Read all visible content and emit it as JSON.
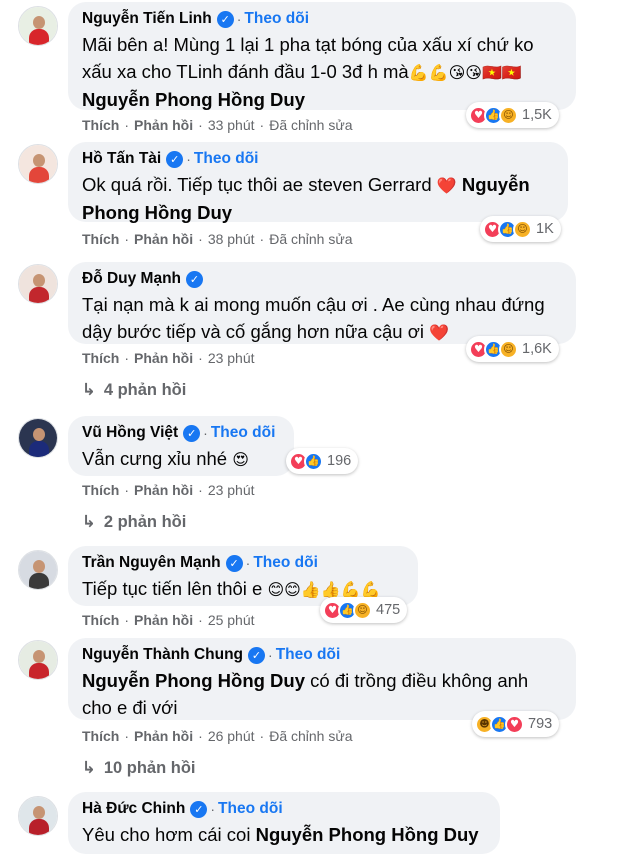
{
  "labels": {
    "like": "Thích",
    "reply": "Phản hồi",
    "follow": "Theo dõi",
    "edited": "Đã chỉnh sửa",
    "separator": "·"
  },
  "colors": {
    "accent": "#1877f2",
    "bubble": "#f0f2f5",
    "meta": "#65676b"
  },
  "comments": [
    {
      "author": "Nguyễn Tiến Linh",
      "text_parts": [
        "Mãi bên a! Mùng 1 lại 1 pha tạt bóng của xấu xí chứ ko xấu xa cho TLinh đánh đầu 1-0 3đ h mà"
      ],
      "emojis": "💪💪😘😘🇻🇳🇻🇳",
      "tag": "Nguyễn Phong Hồng Duy",
      "reaction_count": "1,5K",
      "time": "33 phút",
      "edited": true
    },
    {
      "author": "Hồ Tấn Tài",
      "text_lead": "Ok quá rồi. Tiếp tục thôi ae steven Gerrard",
      "emojis": "❤️",
      "tag": "Nguyễn Phong Hồng Duy",
      "reaction_count": "1K",
      "time": "38 phút",
      "edited": true
    },
    {
      "author": "Đỗ Duy Mạnh",
      "text": "Tại nạn mà k ai mong muốn cậu ơi . Ae cùng nhau đứng dậy bước tiếp và cố gắng hơn nữa cậu ơi",
      "emojis": "❤️",
      "reaction_count": "1,6K",
      "time": "23 phút",
      "replies": "4 phản hồi"
    },
    {
      "author": "Vũ Hồng Việt",
      "text": "Vẫn cưng xỉu nhé",
      "emojis": "😍",
      "reaction_count": "196",
      "time": "23 phút",
      "replies": "2 phản hồi"
    },
    {
      "author": "Trần Nguyên Mạnh",
      "text": "Tiếp tục tiến lên thôi e",
      "emojis": "😊😊👍👍💪💪",
      "reaction_count": "475",
      "time": "25 phút"
    },
    {
      "author": "Nguyễn Thành Chung",
      "tag": "Nguyễn Phong Hồng Duy",
      "text": "có đi trồng điều không anh cho e đi với",
      "reaction_count": "793",
      "time": "26 phút",
      "edited": true,
      "replies": "10 phản hồi"
    },
    {
      "author": "Hà Đức Chinh",
      "text": "Yêu cho hơm cái coi",
      "tag": "Nguyễn Phong Hồng Duy"
    }
  ]
}
